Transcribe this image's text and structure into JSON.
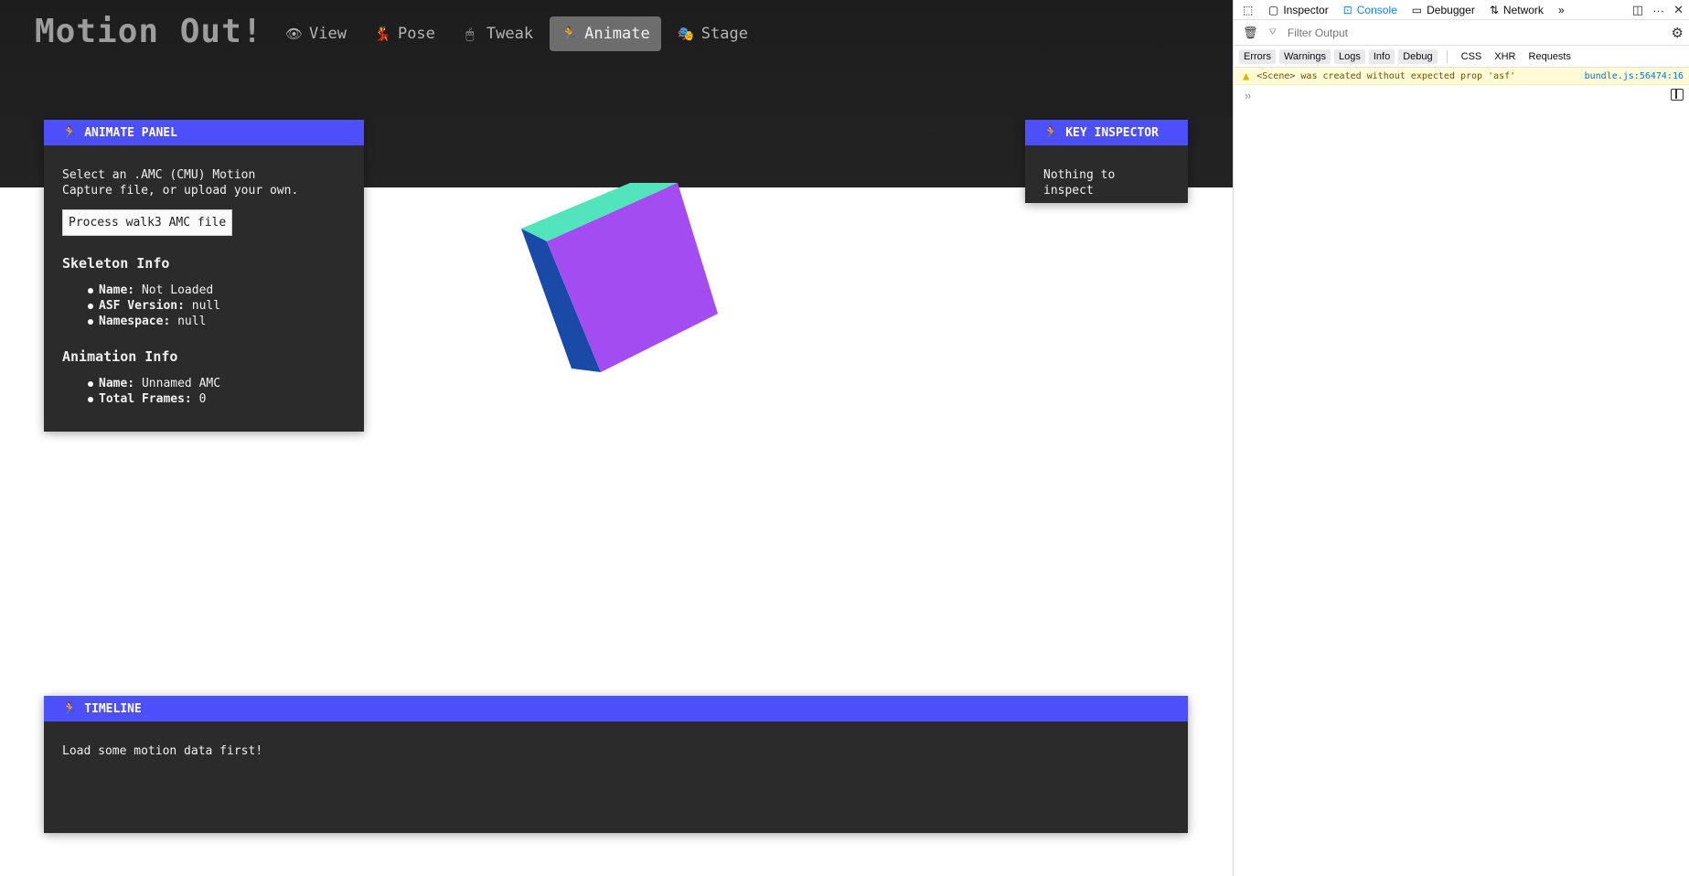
{
  "app": {
    "title": "Motion Out!",
    "nav": [
      {
        "label": "View",
        "icon": "eye-icon",
        "glyph": "👁"
      },
      {
        "label": "Pose",
        "icon": "dancer-icon",
        "glyph": "💃"
      },
      {
        "label": "Tweak",
        "icon": "mouse-icon",
        "glyph": "🖱"
      },
      {
        "label": "Animate",
        "icon": "runner-icon",
        "glyph": "🏃",
        "active": true
      },
      {
        "label": "Stage",
        "icon": "theater-masks-icon",
        "glyph": "🎭"
      }
    ],
    "accent_color": "#4d50fa"
  },
  "animate_panel": {
    "title": "ANIMATE PANEL",
    "description": "Select an .AMC (CMU) Motion Capture file, or upload your own.",
    "process_button": "Process walk3 AMC file",
    "skeleton_title": "Skeleton Info",
    "skeleton": [
      {
        "key": "Name:",
        "value": "Not Loaded"
      },
      {
        "key": "ASF Version:",
        "value": "null"
      },
      {
        "key": "Namespace:",
        "value": "null"
      }
    ],
    "animation_title": "Animation Info",
    "animation": [
      {
        "key": "Name:",
        "value": "Unnamed AMC"
      },
      {
        "key": "Total Frames:",
        "value": "0"
      }
    ]
  },
  "key_inspector": {
    "title": "KEY INSPECTOR",
    "message": "Nothing to inspect"
  },
  "timeline": {
    "title": "TIMELINE",
    "message": "Load some motion data first!"
  },
  "cube_colors": {
    "top": "#52e5bc",
    "front": "#a34cf2",
    "side": "#1a4aa8"
  },
  "devtools": {
    "tabs": [
      "Inspector",
      "Console",
      "Debugger",
      "Network"
    ],
    "active_tab": "Console",
    "filter_placeholder": "Filter Output",
    "categories": [
      "Errors",
      "Warnings",
      "Logs",
      "Info",
      "Debug"
    ],
    "net_categories": [
      "CSS",
      "XHR",
      "Requests"
    ],
    "warning": {
      "message": "<Scene> was created without expected prop 'asf'",
      "source": "bundle.js:56474:16"
    },
    "prompt": "»"
  }
}
